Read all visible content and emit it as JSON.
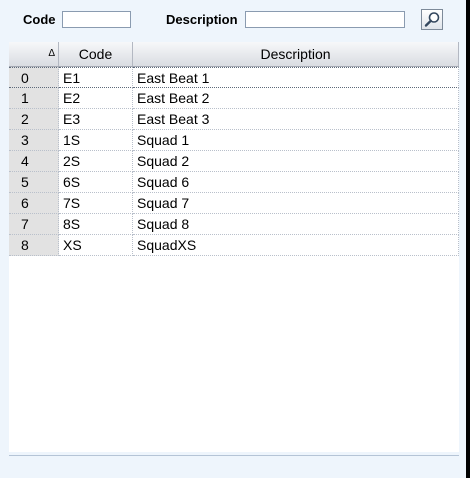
{
  "filter": {
    "code_label": "Code",
    "code_value": "",
    "description_label": "Description",
    "description_value": "",
    "search_icon": "magnifier-icon"
  },
  "table": {
    "headers": {
      "index": "",
      "code": "Code",
      "description": "Description",
      "sort_indicator": "Δ"
    },
    "rows": [
      {
        "index": "0",
        "code": "E1",
        "description": "East Beat 1"
      },
      {
        "index": "1",
        "code": "E2",
        "description": "East Beat 2"
      },
      {
        "index": "2",
        "code": "E3",
        "description": "East Beat 3"
      },
      {
        "index": "3",
        "code": "1S",
        "description": "Squad 1"
      },
      {
        "index": "4",
        "code": "2S",
        "description": "Squad 2"
      },
      {
        "index": "5",
        "code": "6S",
        "description": "Squad 6"
      },
      {
        "index": "6",
        "code": "7S",
        "description": "Squad 7"
      },
      {
        "index": "7",
        "code": "8S",
        "description": "Squad 8"
      },
      {
        "index": "8",
        "code": "XS",
        "description": "SquadXS"
      }
    ]
  }
}
